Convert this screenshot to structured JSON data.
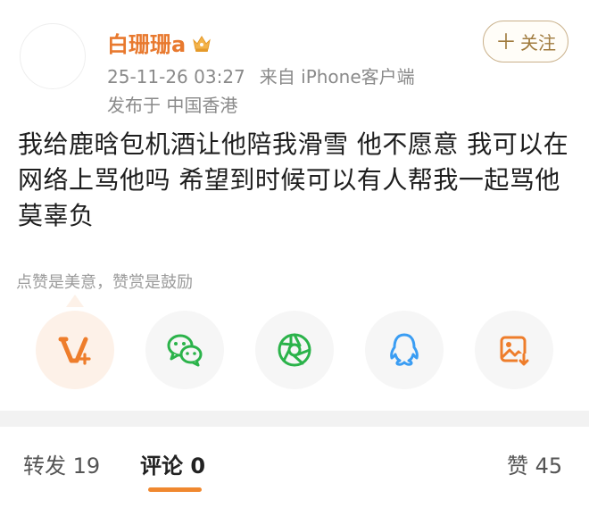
{
  "header": {
    "username": "白珊珊a",
    "timestamp": "25-11-26 03:27",
    "source": "来自 iPhone客户端",
    "location": "发布于 中国香港",
    "follow_plus": "＋",
    "follow_label": "关注"
  },
  "post": {
    "lines": [
      "我给鹿晗包机酒让他陪我滑雪 他不愿意 我可以在",
      "网络上骂他吗 希望到时候可以有人帮我一起骂他",
      "莫辜负"
    ]
  },
  "reward": {
    "hint": "点赞是美意，赞赏是鼓励"
  },
  "share_buttons": [
    {
      "icon": "reward-v-plus-icon"
    },
    {
      "icon": "wechat-icon"
    },
    {
      "icon": "moments-icon"
    },
    {
      "icon": "qq-icon"
    },
    {
      "icon": "save-image-icon"
    }
  ],
  "tabs": {
    "repost": "转发 19",
    "comment": "评论 0",
    "like": "赞 45"
  },
  "colors": {
    "username": "#e8792e",
    "accent": "#f0882f",
    "wechat": "#2bb34a",
    "qq": "#3a9df3",
    "follow_border": "#c9b08a"
  }
}
